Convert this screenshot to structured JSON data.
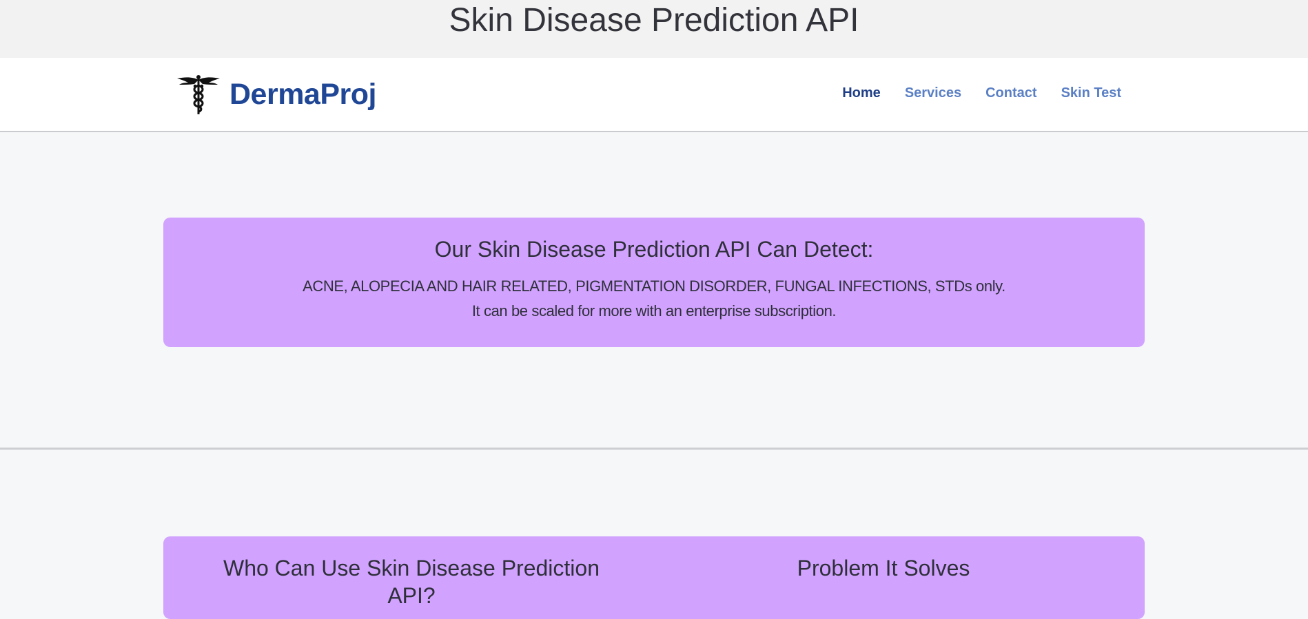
{
  "page": {
    "title": "Skin Disease Prediction API"
  },
  "navbar": {
    "brand_name": "DermaProj",
    "brand_icon": "caduceus-icon",
    "links": [
      {
        "label": "Home",
        "active": true
      },
      {
        "label": "Services",
        "active": false
      },
      {
        "label": "Contact",
        "active": false
      },
      {
        "label": "Skin Test",
        "active": false
      }
    ]
  },
  "detect_card": {
    "heading": "Our Skin Disease Prediction API Can Detect:",
    "conditions": "ACNE, ALOPECIA AND HAIR RELATED, PIGMENTATION DISORDER, FUNGAL INFECTIONS, STDs only.",
    "scaling_note": "It can be scaled for more with an enterprise subscription."
  },
  "info_card": {
    "left_heading": "Who Can Use Skin Disease Prediction API?",
    "right_heading": "Problem It Solves"
  },
  "colors": {
    "card_background": "#d1a3ff",
    "brand": "#1f4796",
    "nav_link": "#5a7fc4",
    "nav_link_active": "#1f3f86"
  }
}
